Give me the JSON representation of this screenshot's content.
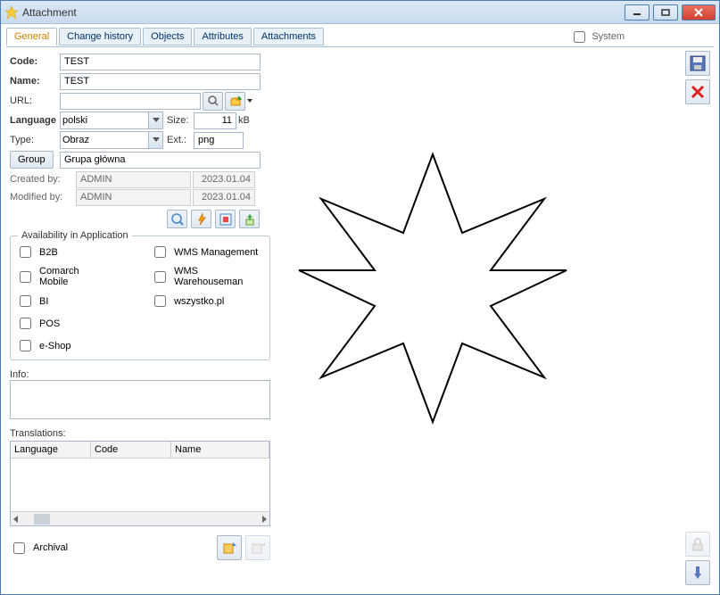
{
  "window": {
    "title": "Attachment"
  },
  "tabs": [
    "General",
    "Change history",
    "Objects",
    "Attributes",
    "Attachments"
  ],
  "system_label": "System",
  "form": {
    "code_label": "Code:",
    "code_value": "TEST",
    "name_label": "Name:",
    "name_value": "TEST",
    "url_label": "URL:",
    "url_value": "",
    "language_label": "Language",
    "language_value": "polski",
    "size_label": "Size:",
    "size_value": "11",
    "size_unit": "kB",
    "type_label": "Type:",
    "type_value": "Obraz",
    "ext_label": "Ext.:",
    "ext_value": "png",
    "group_btn": "Group",
    "group_value": "Grupa główna",
    "created_label": "Created by:",
    "created_user": "ADMIN",
    "created_date": "2023.01.04",
    "modified_label": "Modified by:",
    "modified_user": "ADMIN",
    "modified_date": "2023.01.04"
  },
  "availability": {
    "legend": "Availability in Application",
    "col1": [
      "B2B",
      "Comarch Mobile",
      "BI",
      "POS",
      "e-Shop"
    ],
    "col2": [
      "WMS Management",
      "WMS Warehouseman",
      "wszystko.pl"
    ]
  },
  "info_label": "Info:",
  "translations": {
    "label": "Translations:",
    "headers": [
      "Language",
      "Code",
      "Name"
    ]
  },
  "archival_label": "Archival"
}
